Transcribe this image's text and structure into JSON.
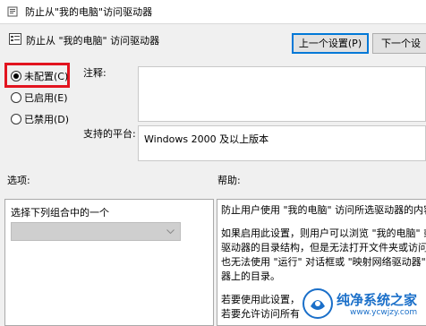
{
  "window": {
    "title": "防止从\"我的电脑\"访问驱动器"
  },
  "header": {
    "policy_name": "防止从 \"我的电脑\" 访问驱动器",
    "prev_button": "上一个设置(P)",
    "next_button": "下一个设"
  },
  "radio_options": [
    {
      "label": "未配置(C)",
      "checked": true
    },
    {
      "label": "已启用(E)",
      "checked": false
    },
    {
      "label": "已禁用(D)",
      "checked": false
    }
  ],
  "comment": {
    "label": "注释:",
    "value": ""
  },
  "supported_on": {
    "label": "支持的平台:",
    "value": "Windows 2000 及以上版本"
  },
  "options": {
    "label": "选项:",
    "combo_label": "选择下列组合中的一个",
    "combo_value": ""
  },
  "help": {
    "label": "帮助:",
    "paragraphs": [
      "防止用户使用 \"我的电脑\" 访问所选驱动器的内容。",
      "如果启用此设置，则用户可以浏览 \"我的电脑\" 或\n驱动器的目录结构，但是无法打开文件夹或访问其\n也无法使用 \"运行\" 对话框或 \"映射网络驱动器\" 对\n器上的目录。",
      "若要使用此设置，\n若要允许访问所有"
    ]
  },
  "watermark": {
    "brand": "纯净系统之家",
    "url": "www.ycwjzy.com"
  },
  "colors": {
    "highlight": "#e2141f",
    "focus": "#0078d7",
    "watermark": "#1a6fc9"
  }
}
